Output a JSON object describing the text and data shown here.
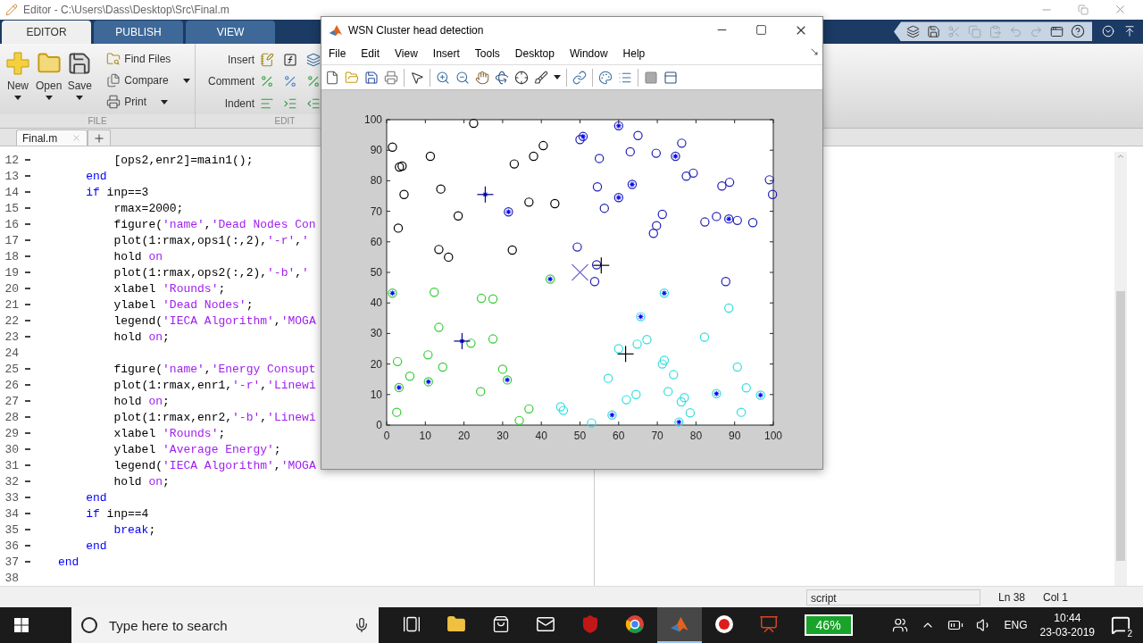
{
  "editor": {
    "title": "Editor - C:\\Users\\Dass\\Desktop\\Src\\Final.m"
  },
  "ribbon_tabs": [
    {
      "label": "EDITOR",
      "selected": true
    },
    {
      "label": "PUBLISH",
      "selected": false
    },
    {
      "label": "VIEW",
      "selected": false
    }
  ],
  "file_group": {
    "label": "FILE",
    "large_buttons": [
      {
        "kind": "new",
        "label": "New"
      },
      {
        "kind": "open",
        "label": "Open"
      },
      {
        "kind": "save",
        "label": "Save"
      }
    ],
    "small_buttons": [
      {
        "kind": "find",
        "label": "Find Files",
        "dropdown": false
      },
      {
        "kind": "compare",
        "label": "Compare",
        "dropdown": true
      },
      {
        "kind": "print",
        "label": "Print",
        "dropdown": true
      }
    ]
  },
  "edit_group": {
    "label": "EDIT",
    "rows": [
      {
        "kind": "insert",
        "label": "Insert"
      },
      {
        "kind": "comment",
        "label": "Comment"
      },
      {
        "kind": "indent",
        "label": "Indent"
      }
    ]
  },
  "file_tabs": [
    {
      "label": "Final.m",
      "selected": true
    }
  ],
  "code": {
    "lines": [
      {
        "number": "12",
        "executable": true,
        "tokens": [
          {
            "kind": "code",
            "text": "        [ops2,enr2]=main1();"
          }
        ]
      },
      {
        "number": "13",
        "executable": true,
        "tokens": [
          {
            "kind": "keyword",
            "text": "    end"
          }
        ]
      },
      {
        "number": "14",
        "executable": true,
        "tokens": [
          {
            "kind": "keyword",
            "text": "    if"
          },
          {
            "kind": "code",
            "text": " inp==3"
          }
        ]
      },
      {
        "number": "15",
        "executable": true,
        "tokens": [
          {
            "kind": "code",
            "text": "        rmax=2000;"
          }
        ]
      },
      {
        "number": "16",
        "executable": true,
        "tokens": [
          {
            "kind": "code",
            "text": "        figure("
          },
          {
            "kind": "string",
            "text": "'name'"
          },
          {
            "kind": "code",
            "text": ","
          },
          {
            "kind": "string",
            "text": "'Dead Nodes Con"
          }
        ]
      },
      {
        "number": "17",
        "executable": true,
        "tokens": [
          {
            "kind": "code",
            "text": "        plot(1:rmax,ops1(:,2),"
          },
          {
            "kind": "string",
            "text": "'-r'"
          },
          {
            "kind": "code",
            "text": ","
          },
          {
            "kind": "string",
            "text": "'"
          }
        ]
      },
      {
        "number": "18",
        "executable": true,
        "tokens": [
          {
            "kind": "code",
            "text": "        hold "
          },
          {
            "kind": "string",
            "text": "on"
          }
        ]
      },
      {
        "number": "19",
        "executable": true,
        "tokens": [
          {
            "kind": "code",
            "text": "        plot(1:rmax,ops2(:,2),"
          },
          {
            "kind": "string",
            "text": "'-b'"
          },
          {
            "kind": "code",
            "text": ","
          },
          {
            "kind": "string",
            "text": "'"
          }
        ]
      },
      {
        "number": "20",
        "executable": true,
        "tokens": [
          {
            "kind": "code",
            "text": "        xlabel "
          },
          {
            "kind": "string",
            "text": "'Rounds'"
          },
          {
            "kind": "code",
            "text": ";"
          }
        ]
      },
      {
        "number": "21",
        "executable": true,
        "tokens": [
          {
            "kind": "code",
            "text": "        ylabel "
          },
          {
            "kind": "string",
            "text": "'Dead Nodes'"
          },
          {
            "kind": "code",
            "text": ";"
          }
        ]
      },
      {
        "number": "22",
        "executable": true,
        "tokens": [
          {
            "kind": "code",
            "text": "        legend("
          },
          {
            "kind": "string",
            "text": "'IECA Algorithm'"
          },
          {
            "kind": "code",
            "text": ","
          },
          {
            "kind": "string",
            "text": "'MOGA"
          }
        ]
      },
      {
        "number": "23",
        "executable": true,
        "tokens": [
          {
            "kind": "code",
            "text": "        hold "
          },
          {
            "kind": "string",
            "text": "on"
          },
          {
            "kind": "code",
            "text": ";"
          }
        ]
      },
      {
        "number": "24",
        "executable": false
      },
      {
        "number": "25",
        "executable": true,
        "tokens": [
          {
            "kind": "code",
            "text": "        figure("
          },
          {
            "kind": "string",
            "text": "'name'"
          },
          {
            "kind": "code",
            "text": ","
          },
          {
            "kind": "string",
            "text": "'Energy Consupt"
          }
        ]
      },
      {
        "number": "26",
        "executable": true,
        "tokens": [
          {
            "kind": "code",
            "text": "        plot(1:rmax,enr1,"
          },
          {
            "kind": "string",
            "text": "'-r'"
          },
          {
            "kind": "code",
            "text": ","
          },
          {
            "kind": "string",
            "text": "'Linewi"
          }
        ]
      },
      {
        "number": "27",
        "executable": true,
        "tokens": [
          {
            "kind": "code",
            "text": "        hold "
          },
          {
            "kind": "string",
            "text": "on"
          },
          {
            "kind": "code",
            "text": ";"
          }
        ]
      },
      {
        "number": "28",
        "executable": true,
        "tokens": [
          {
            "kind": "code",
            "text": "        plot(1:rmax,enr2,"
          },
          {
            "kind": "string",
            "text": "'-b'"
          },
          {
            "kind": "code",
            "text": ","
          },
          {
            "kind": "string",
            "text": "'Linewi"
          }
        ]
      },
      {
        "number": "29",
        "executable": true,
        "tokens": [
          {
            "kind": "code",
            "text": "        xlabel "
          },
          {
            "kind": "string",
            "text": "'Rounds'"
          },
          {
            "kind": "code",
            "text": ";"
          }
        ]
      },
      {
        "number": "30",
        "executable": true,
        "tokens": [
          {
            "kind": "code",
            "text": "        ylabel "
          },
          {
            "kind": "string",
            "text": "'Average Energy'"
          },
          {
            "kind": "code",
            "text": ";"
          }
        ]
      },
      {
        "number": "31",
        "executable": true,
        "tokens": [
          {
            "kind": "code",
            "text": "        legend("
          },
          {
            "kind": "string",
            "text": "'IECA Algorithm'"
          },
          {
            "kind": "code",
            "text": ","
          },
          {
            "kind": "string",
            "text": "'MOGA"
          }
        ]
      },
      {
        "number": "32",
        "executable": true,
        "tokens": [
          {
            "kind": "code",
            "text": "        hold "
          },
          {
            "kind": "string",
            "text": "on"
          },
          {
            "kind": "code",
            "text": ";"
          }
        ]
      },
      {
        "number": "33",
        "executable": true,
        "tokens": [
          {
            "kind": "keyword",
            "text": "    end"
          }
        ]
      },
      {
        "number": "34",
        "executable": true,
        "tokens": [
          {
            "kind": "keyword",
            "text": "    if"
          },
          {
            "kind": "code",
            "text": " inp==4"
          }
        ]
      },
      {
        "number": "35",
        "executable": true,
        "tokens": [
          {
            "kind": "keyword",
            "text": "        break"
          },
          {
            "kind": "code",
            "text": ";"
          }
        ]
      },
      {
        "number": "36",
        "executable": true,
        "tokens": [
          {
            "kind": "keyword",
            "text": "    end"
          }
        ]
      },
      {
        "number": "37",
        "executable": true,
        "tokens": [
          {
            "kind": "keyword",
            "text": "end"
          }
        ]
      },
      {
        "number": "38",
        "executable": false
      }
    ]
  },
  "status_bar": {
    "file_type": "script",
    "ln_label": "Ln",
    "ln": "38",
    "col_label": "Col",
    "col": "1"
  },
  "figure": {
    "title": "WSN Cluster head detection",
    "menu": [
      "File",
      "Edit",
      "View",
      "Insert",
      "Tools",
      "Desktop",
      "Window",
      "Help"
    ],
    "chart_data": {
      "type": "scatter",
      "xlim": [
        0,
        100
      ],
      "ylim": [
        0,
        100
      ],
      "xticks": [
        0,
        10,
        20,
        30,
        40,
        50,
        60,
        70,
        80,
        90,
        100
      ],
      "yticks": [
        0,
        10,
        20,
        30,
        40,
        50,
        60,
        70,
        80,
        90,
        100
      ],
      "series": [
        {
          "color": "#000000",
          "marker": "circle",
          "x": [
            1.5,
            3.3,
            4,
            11.3,
            22.5,
            4.5,
            14,
            18.5,
            3,
            13.5,
            16,
            32.5,
            33,
            38,
            40.5,
            36.8,
            43.5
          ],
          "values": [
            91,
            84.5,
            84.8,
            88,
            98.8,
            75.5,
            77.3,
            68.5,
            64.5,
            57.5,
            55,
            57.3,
            85.5,
            88,
            91.5,
            73,
            72.5
          ]
        },
        {
          "color": "#1f1fb4",
          "marker": "circle",
          "x": [
            50,
            50.8,
            55,
            60,
            65,
            63,
            69.7,
            74.7,
            76.3,
            77.5,
            79.3,
            54.5,
            56.3,
            60,
            63.5,
            31.5,
            69,
            69.8,
            71.3,
            82.3,
            85.3,
            86.7,
            88.7,
            88.5,
            90.7,
            94.7,
            99,
            99.8,
            49.3,
            54.3,
            53.8,
            87.7
          ],
          "values": [
            93.5,
            94.5,
            87.3,
            98,
            94.8,
            89.5,
            89,
            88,
            92.3,
            81.5,
            82.5,
            78,
            71,
            74.5,
            78.8,
            69.8,
            62.8,
            65.3,
            69,
            66.5,
            68.3,
            78.3,
            79.5,
            67.5,
            67,
            66.3,
            80.3,
            75.5,
            58.3,
            52.5,
            47,
            47
          ]
        },
        {
          "color": "#33cc33",
          "marker": "circle",
          "x": [
            12.3,
            24.5,
            27.5,
            13.5,
            21.8,
            27.5,
            10.7,
            2.8,
            14.5,
            6,
            30,
            24.3,
            2.6,
            36.8,
            34.3,
            42.3,
            1.5,
            3.2,
            10.8,
            31.2
          ],
          "values": [
            43.5,
            41.5,
            41.3,
            32,
            26.8,
            28.2,
            23,
            20.8,
            19,
            16,
            18.3,
            11,
            4.2,
            5.3,
            1.5,
            47.8,
            43.2,
            12.3,
            14.2,
            14.8
          ]
        },
        {
          "color": "#33dddd",
          "marker": "circle",
          "x": [
            88.5,
            82.2,
            60,
            64.8,
            67.3,
            71.8,
            71.3,
            74.2,
            57.3,
            72.8,
            64.5,
            62,
            77,
            76.2,
            78.5,
            90.7,
            93,
            91.7,
            45,
            45.7,
            53,
            71.8,
            65.7,
            58.3,
            75.6,
            85.3,
            96.7
          ],
          "values": [
            38.3,
            28.8,
            25,
            26.5,
            28,
            21.2,
            20,
            16.5,
            15.3,
            11,
            10,
            8.3,
            9,
            7.6,
            4,
            19,
            12.2,
            4.2,
            6,
            4.8,
            0.7,
            43.2,
            35.5,
            3.3,
            1,
            10.3,
            9.8
          ]
        },
        {
          "color": "#0000ff",
          "marker": "star",
          "x": [
            60,
            50.8,
            74.7,
            63.5,
            60,
            31.5,
            88.5,
            42.3,
            1.5,
            71.8,
            65.7,
            3.2,
            10.8,
            31.2,
            58.3,
            75.6,
            85.3,
            96.7,
            25.5,
            19.5
          ],
          "values": [
            98,
            94.5,
            88,
            78.8,
            74.5,
            69.8,
            67.5,
            47.8,
            43.2,
            43.2,
            35.5,
            12.3,
            14.2,
            14.8,
            3.3,
            1,
            10.3,
            9.8,
            75.5,
            27.5
          ]
        },
        {
          "color": "#00008b",
          "marker": "plus",
          "x": [
            25.5,
            19.5
          ],
          "values": [
            75.5,
            27.5
          ]
        },
        {
          "color": "#000000",
          "marker": "plus",
          "x": [
            55.5,
            61.8
          ],
          "values": [
            52.3,
            23.3
          ]
        },
        {
          "color": "#7a6fd6",
          "marker": "cross",
          "x": [
            50
          ],
          "values": [
            50
          ]
        }
      ]
    }
  },
  "taskbar": {
    "search_placeholder": "Type here to search",
    "apps": [
      {
        "kind": "taskview",
        "active": false
      },
      {
        "kind": "explorer",
        "active": false
      },
      {
        "kind": "store",
        "active": false
      },
      {
        "kind": "mail",
        "active": false
      },
      {
        "kind": "antivirus",
        "active": false
      },
      {
        "kind": "browser",
        "active": false
      },
      {
        "kind": "matlab",
        "active": true
      },
      {
        "kind": "recorder",
        "active": false
      },
      {
        "kind": "powerpoint",
        "active": false
      }
    ],
    "battery": "46%",
    "language": "ENG",
    "time": "10:44",
    "date": "23-03-2019",
    "notifications": "2"
  }
}
